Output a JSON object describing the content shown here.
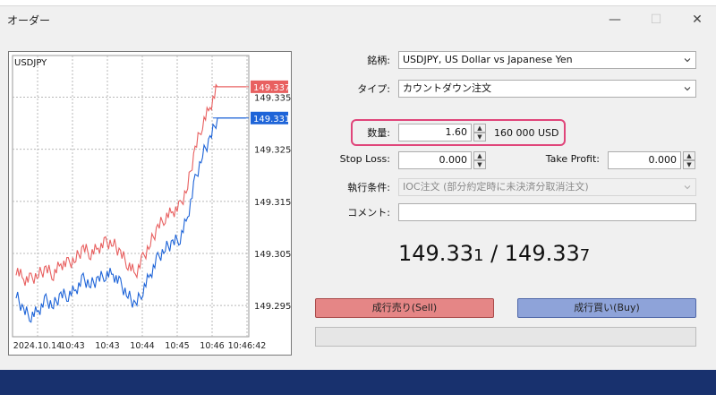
{
  "window": {
    "title": "オーダー",
    "controls": {
      "minimize": "—",
      "maximize": "☐",
      "close": "✕"
    }
  },
  "chart_data": {
    "type": "line",
    "title": "USDJPY",
    "x_ticks": [
      "2024.10.14",
      "10:43",
      "10:43",
      "10:44",
      "10:45",
      "10:46",
      "10:46:42"
    ],
    "ylim": [
      149.289,
      149.343
    ],
    "y_ticks": [
      149.295,
      149.305,
      149.315,
      149.325,
      149.335
    ],
    "grid": true,
    "series": [
      {
        "role": "ask",
        "color": "#e86060",
        "current": "149.337",
        "values": [
          149.302,
          149.3,
          149.3,
          149.301,
          149.302,
          149.301,
          149.303,
          149.303,
          149.304,
          149.306,
          149.305,
          149.306,
          149.307,
          149.307,
          149.305,
          149.303,
          149.301,
          149.304,
          149.307,
          149.31,
          149.312,
          149.313,
          149.314,
          149.318,
          149.325,
          149.33,
          149.333,
          149.337,
          149.337,
          149.337,
          149.337
        ]
      },
      {
        "role": "bid",
        "color": "#1e64d8",
        "current": "149.331",
        "values": [
          149.297,
          149.294,
          149.293,
          149.294,
          149.296,
          149.295,
          149.297,
          149.297,
          149.298,
          149.3,
          149.299,
          149.3,
          149.301,
          149.301,
          149.299,
          149.297,
          149.295,
          149.298,
          149.301,
          149.304,
          149.306,
          149.307,
          149.308,
          149.312,
          149.319,
          149.324,
          149.327,
          149.331,
          149.331,
          149.331,
          149.331
        ]
      }
    ]
  },
  "form": {
    "symbol": {
      "label": "銘柄:",
      "value": "USDJPY, US Dollar vs Japanese Yen"
    },
    "type": {
      "label": "タイプ:",
      "value": "カウントダウン注文"
    },
    "volume": {
      "label": "数量:",
      "value": "1.60",
      "unit": "160 000 USD"
    },
    "stop_loss": {
      "label": "Stop Loss:",
      "value": "0.000"
    },
    "take_profit": {
      "label": "Take Profit:",
      "value": "0.000"
    },
    "fill_policy": {
      "label": "執行条件:",
      "value": "IOC注文 (部分約定時に未決済分取消注文)"
    },
    "comment": {
      "label": "コメント:",
      "value": ""
    }
  },
  "quote": {
    "bid_main": "149.33",
    "bid_last": "1",
    "separator": " / ",
    "ask_main": "149.33",
    "ask_last": "7"
  },
  "buttons": {
    "sell": "成行売り(Sell)",
    "buy": "成行買い(Buy)"
  },
  "spin_symbols": {
    "up": "▲",
    "down": "▼"
  }
}
